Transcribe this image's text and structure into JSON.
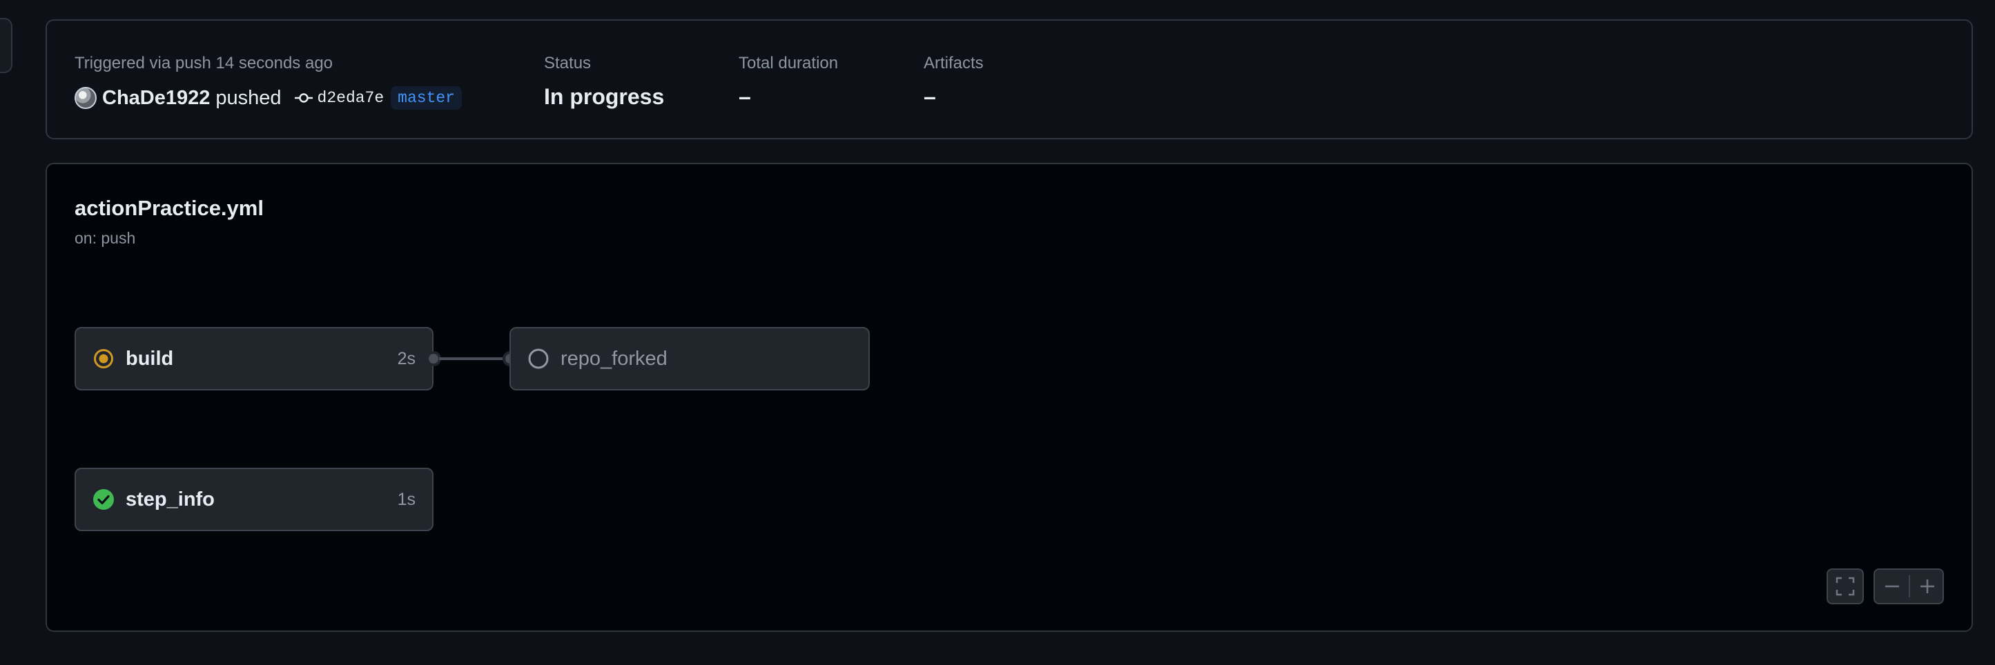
{
  "summary": {
    "trigger_text": "Triggered via push 14 seconds ago",
    "actor": "ChaDe1922",
    "action": "pushed",
    "commit_sha": "d2eda7e",
    "branch": "master",
    "status_label": "Status",
    "status_value": "In progress",
    "duration_label": "Total duration",
    "duration_value": "–",
    "artifacts_label": "Artifacts",
    "artifacts_value": "–"
  },
  "workflow": {
    "file_name": "actionPractice.yml",
    "trigger": "on: push"
  },
  "jobs": [
    {
      "name": "build",
      "status": "in_progress",
      "duration": "2s",
      "status_icon": "in-progress-dot-icon"
    },
    {
      "name": "repo_forked",
      "status": "queued",
      "duration": "",
      "status_icon": "pending-circle-icon"
    },
    {
      "name": "step_info",
      "status": "success",
      "duration": "1s",
      "status_icon": "check-circle-icon"
    }
  ],
  "controls": {
    "fullscreen_icon": "fullscreen-icon",
    "zoom_out_icon": "minus-icon",
    "zoom_in_icon": "plus-icon"
  },
  "colors": {
    "in_progress": "#d29922",
    "success": "#3fb950",
    "queued": "#9198a1",
    "branch": "#4493f8"
  }
}
